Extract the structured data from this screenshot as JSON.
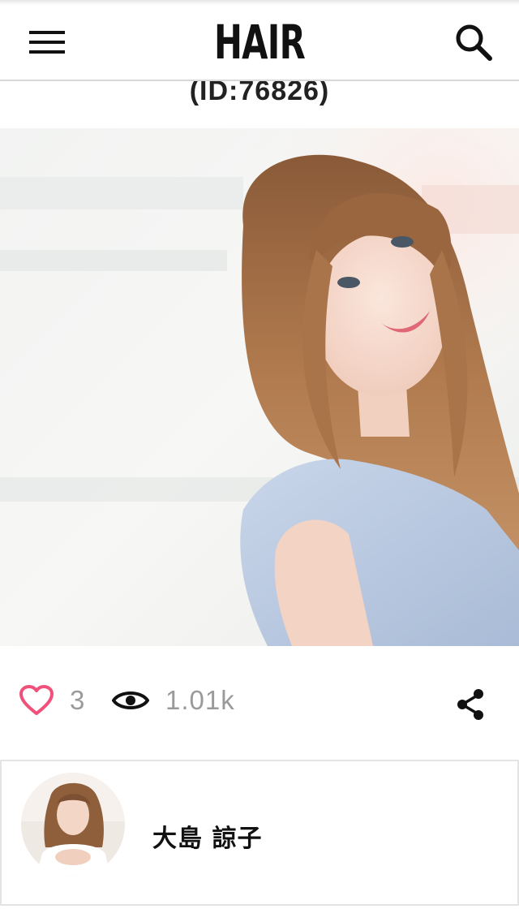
{
  "header": {
    "logo": "HAIR",
    "menu_icon": "hamburger-menu-icon",
    "search_icon": "search-icon"
  },
  "style_title": {
    "id_text": "(ID:76826)"
  },
  "photo": {
    "subject": "hair-style-photo"
  },
  "stats": {
    "likes": "3",
    "views": "1.01k",
    "like_icon": "heart-icon",
    "view_icon": "eye-icon",
    "share_icon": "share-icon"
  },
  "author": {
    "name": "大島 諒子",
    "avatar_icon": "avatar"
  },
  "colors": {
    "accent_pink": "#f0507a",
    "text_dark": "#111111",
    "text_muted": "#9a9a9a",
    "divider": "#e4e4e4"
  }
}
